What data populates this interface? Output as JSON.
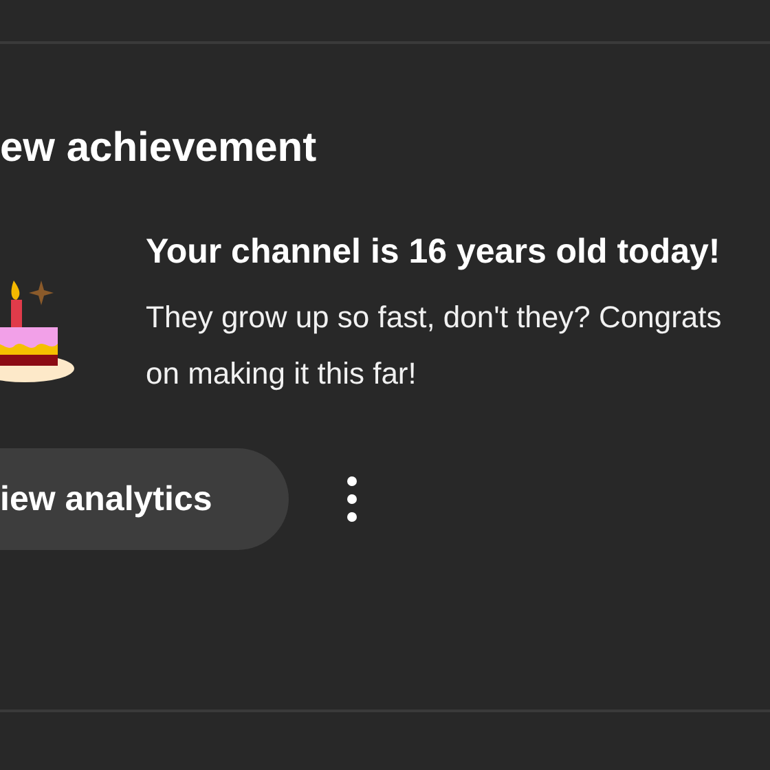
{
  "card": {
    "title": "ew achievement",
    "heading": "Your channel is 16 years old today!",
    "message": "They grow up so fast, don't they? Congrats on making it this far!",
    "button": "iew analytics"
  }
}
